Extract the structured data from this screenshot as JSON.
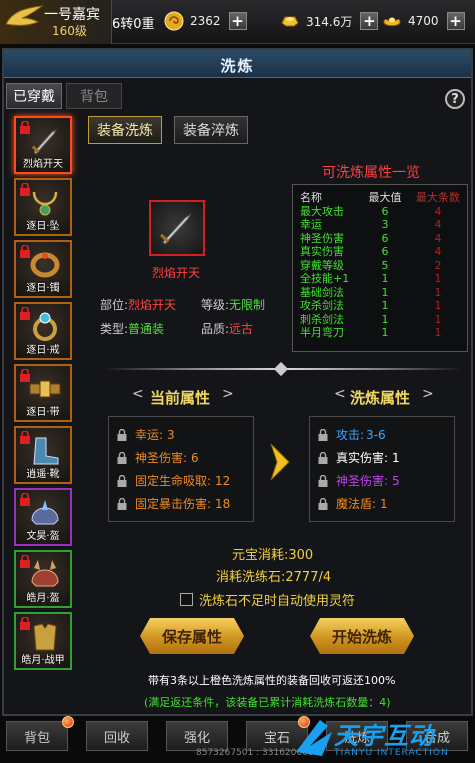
{
  "player": {
    "name": "一号嘉宾",
    "level": "160级",
    "rebirth": "6转0重"
  },
  "resources": [
    {
      "icon": "coin-icon",
      "value": "2362"
    },
    {
      "icon": "gold-ingot-icon",
      "value": "314.6万"
    },
    {
      "icon": "yuanbao-icon",
      "value": "4700"
    }
  ],
  "panel": {
    "title": "洗炼"
  },
  "top_tabs": {
    "equipped": "已穿戴",
    "bag": "背包"
  },
  "help": "?",
  "sub_tabs": {
    "refine": "装备洗炼",
    "temper": "装备淬炼"
  },
  "equip_slots": [
    {
      "label": "烈焰开天",
      "icon": "sword-icon"
    },
    {
      "label": "逐日·坠",
      "icon": "necklace-icon"
    },
    {
      "label": "逐日·镯",
      "icon": "bracelet-icon"
    },
    {
      "label": "逐日·戒",
      "icon": "ring-icon"
    },
    {
      "label": "逐日·带",
      "icon": "belt-icon"
    },
    {
      "label": "逍遥·靴",
      "icon": "boots-icon"
    },
    {
      "label": "文昊·盔",
      "icon": "helmet-icon"
    },
    {
      "label": "皓月·盔",
      "icon": "helmet-icon"
    },
    {
      "label": "皓月·战甲",
      "icon": "armor-icon"
    }
  ],
  "item": {
    "name": "烈焰开天",
    "slot_label": "部位:",
    "slot": "烈焰开天",
    "level_label": "等级:",
    "level": "无限制",
    "type_label": "类型:",
    "type": "普通装",
    "quality_label": "品质:",
    "quality": "远古"
  },
  "refine_list": {
    "title": "可洗炼属性一览",
    "headers": [
      "名称",
      "最大值",
      "最大条数"
    ],
    "rows": [
      [
        "最大攻击",
        "6",
        "4"
      ],
      [
        "幸运",
        "3",
        "4"
      ],
      [
        "神圣伤害",
        "6",
        "4"
      ],
      [
        "真实伤害",
        "6",
        "4"
      ],
      [
        "穿戴等级",
        "5",
        "2"
      ],
      [
        "全技能+1",
        "1",
        "1"
      ],
      [
        "基础剑法",
        "1",
        "1"
      ],
      [
        "攻杀剑法",
        "1",
        "1"
      ],
      [
        "刺杀剑法",
        "1",
        "1"
      ],
      [
        "半月弯刀",
        "1",
        "1"
      ]
    ]
  },
  "current": {
    "title": "当前属性",
    "attrs": [
      {
        "name": "幸运:",
        "value": "3"
      },
      {
        "name": "神圣伤害:",
        "value": "6"
      },
      {
        "name": "固定生命吸取:",
        "value": "12"
      },
      {
        "name": "固定暴击伤害:",
        "value": "18"
      }
    ]
  },
  "refined": {
    "title": "洗炼属性",
    "attrs": [
      {
        "name": "攻击:",
        "value": "3-6",
        "color": "#3aa6ff"
      },
      {
        "name": "真实伤害:",
        "value": "1",
        "color": "#ffffff"
      },
      {
        "name": "神圣伤害:",
        "value": "5",
        "color": "#c040f0"
      },
      {
        "name": "魔法盾:",
        "value": "1",
        "color": "#f08a20"
      }
    ]
  },
  "costs": {
    "yuanbao_label": "元宝消耗:",
    "yuanbao": "300",
    "stone_label": "消耗洗练石:",
    "stone": "2777/4",
    "auto_use": "洗炼石不足时自动使用灵符"
  },
  "buttons": {
    "save": "保存属性",
    "start": "开始洗炼"
  },
  "notes": {
    "line1": "带有3条以上橙色洗炼属性的装备回收可返还100%",
    "line2": "(满足返还条件，该装备已累计消耗洗炼石数量：4)"
  },
  "bottom": [
    "背包",
    "回收",
    "强化",
    "宝石",
    "洗炼",
    "合成"
  ],
  "coords": "8573267501 : 331620000",
  "watermark": {
    "text": "天宇互动",
    "sub": "TIANYU INTERACTION"
  }
}
